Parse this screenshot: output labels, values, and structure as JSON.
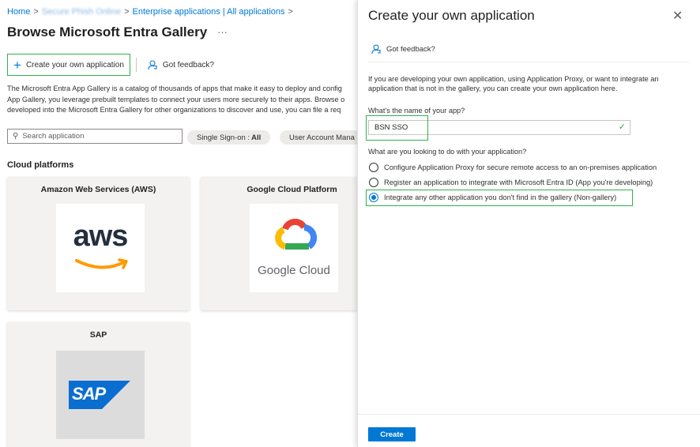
{
  "breadcrumb": {
    "home": "Home",
    "tenant": "Secure Phish Online",
    "enterprise_apps": "Enterprise applications | All applications"
  },
  "page": {
    "title": "Browse Microsoft Entra Gallery",
    "more": "···"
  },
  "toolbar": {
    "create_label": "Create your own application",
    "feedback_label": "Got feedback?"
  },
  "description": {
    "line1": "The Microsoft Entra App Gallery is a catalog of thousands of apps that make it easy to deploy and config",
    "line2": "App Gallery, you leverage prebuilt templates to connect your users more securely to their apps. Browse o",
    "line3": "developed into the Microsoft Entra Gallery for other organizations to discover and use, you can file a req"
  },
  "search": {
    "placeholder": "Search application"
  },
  "filters": [
    {
      "label": "Single Sign-on : ",
      "value": "All"
    },
    {
      "label": "User Account Mana",
      "value": ""
    }
  ],
  "section": {
    "cloud_platforms": "Cloud platforms"
  },
  "tiles": [
    {
      "name": "Amazon Web Services (AWS)",
      "logo_text": "aws",
      "icon": "aws-logo"
    },
    {
      "name": "Google Cloud Platform",
      "logo_text": "Google Cloud",
      "icon": "google-cloud-logo"
    },
    {
      "name": "SAP",
      "logo_text": "SAP",
      "icon": "sap-logo"
    }
  ],
  "panel": {
    "title": "Create your own application",
    "close": "✕",
    "feedback_label": "Got feedback?",
    "desc_line1": "If you are developing your own application, using Application Proxy, or want to integrate an",
    "desc_line2": "application that is not in the gallery, you can create your own application here.",
    "name_label": "What's the name of your app?",
    "name_value": "BSN SSO",
    "purpose_label": "What are you looking to do with your application?",
    "options": [
      {
        "label": "Configure Application Proxy for secure remote access to an on-premises application",
        "selected": false
      },
      {
        "label": "Register an application to integrate with Microsoft Entra ID (App you're developing)",
        "selected": false
      },
      {
        "label": "Integrate any other application you don't find in the gallery (Non-gallery)",
        "selected": true
      }
    ],
    "create_label": "Create"
  },
  "colors": {
    "accent": "#0078d4",
    "highlight": "#2fb24c",
    "aws_orange": "#ff9900",
    "sap_blue": "#0a6ed1"
  }
}
